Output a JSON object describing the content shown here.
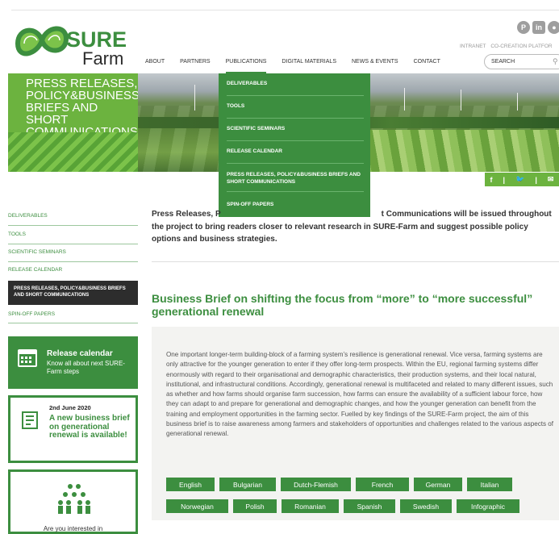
{
  "header": {
    "logo_sure": "SURE",
    "logo_farm": "Farm",
    "social_icons": [
      "pinterest-icon",
      "linkedin-icon",
      "other-social-icon"
    ],
    "top_links": [
      "INTRANET",
      "CO-CREATION PLATFOR"
    ],
    "search_placeholder": "SEARCH",
    "nav": [
      "ABOUT",
      "PARTNERS",
      "PUBLICATIONS",
      "DIGITAL MATERIALS",
      "NEWS & EVENTS",
      "CONTACT"
    ],
    "active_nav": "PUBLICATIONS"
  },
  "hero": {
    "title": "PRESS RELEASES, POLICY&BUSINESS BRIEFS AND SHORT COMMUNICATIONS",
    "share": [
      "f",
      "|",
      "t",
      "|",
      "✉"
    ]
  },
  "dropdown": {
    "items": [
      "DELIVERABLES",
      "TOOLS",
      "SCIENTIFIC SEMINARS",
      "RELEASE CALENDAR",
      "PRESS RELEASES, POLICY&BUSINESS BRIEFS AND SHORT COMMUNICATIONS",
      "SPIN-OFF PAPERS"
    ]
  },
  "sidebar": {
    "items": [
      "DELIVERABLES",
      "TOOLS",
      "SCIENTIFIC SEMINARS",
      "RELEASE CALENDAR",
      "PRESS RELEASES, POLICY&BUSINESS BRIEFS AND SHORT COMMUNICATIONS",
      "SPIN-OFF PAPERS"
    ],
    "release_calendar": {
      "title": "Release calendar",
      "subtitle": "Know all about next SURE-Farm steps"
    },
    "news": {
      "date": "2nd June 2020",
      "headline": "A new business brief on generational renewal is available!"
    },
    "interest": {
      "question": "Are you interested in"
    }
  },
  "main": {
    "intro_left": "Press Releases, P",
    "intro_right": "t Communications will be issued throughout",
    "intro_rest": "the project to bring readers closer to relevant research in SURE-Farm and suggest possible policy options and business strategies.",
    "article_title": "Business Brief on shifting the focus from “more” to “more successful” generational renewal",
    "article_body": "One important longer-term building-block of a farming system’s resilience is generational renewal. Vice versa, farming systems are only attractive for the younger generation to enter if they offer long-term prospects. Within the EU, regional farming systems differ enormously with regard to their organisational and demographic characteristics, their production systems, and their local natural, institutional, and infrastructural conditions. Accordingly, generational renewal is multifaceted and related to many different issues, such as whether and how farms should organise farm succession, how farms can ensure the availability of a sufficient labour force, how they can adapt to and prepare for generational and demographic changes, and how the younger generation can benefit from the training and employment opportunities in the farming sector. Fuelled by key findings of the SURE-Farm project, the aim of this business brief is to raise awareness among farmers and stakeholders of opportunities and challenges related to the various aspects of generational renewal.",
    "languages_row1": [
      "English",
      "Bulgarian",
      "Dutch-Flemish",
      "French",
      "German",
      "Italian"
    ],
    "languages_row2": [
      "Norwegian",
      "Polish",
      "Romanian",
      "Spanish",
      "Swedish",
      "Infographic"
    ]
  },
  "colors": {
    "brand_green": "#3c8e3f",
    "light_green": "#6cb33f",
    "dark": "#2d2d2d"
  }
}
